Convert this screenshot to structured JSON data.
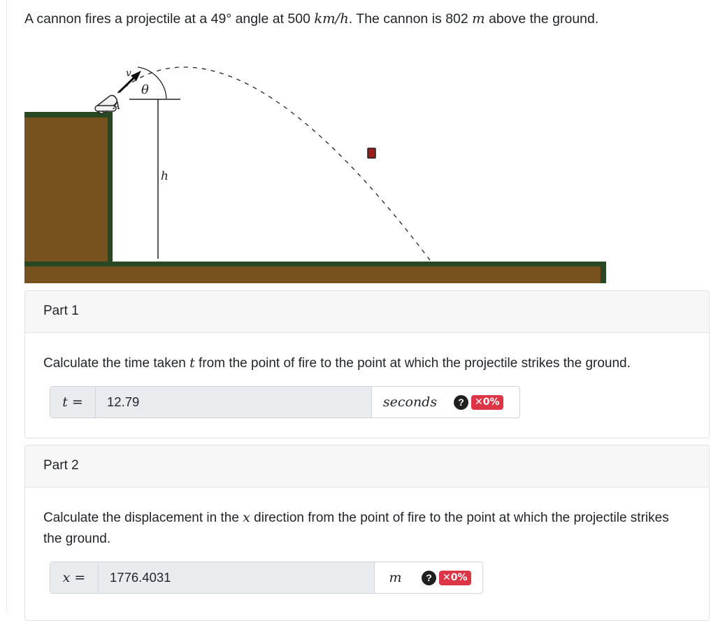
{
  "question": {
    "intro": "A cannon fires a projectile at a ",
    "angle": "49°",
    "mid1": " angle at 500 ",
    "speed_unit": "km/h",
    "mid2": ". The cannon is 802 ",
    "height_unit": "m",
    "end": " above the ground."
  },
  "figure": {
    "label_v": "v",
    "label_theta": "θ",
    "label_a": "A",
    "label_h": "h",
    "colors": {
      "dirt": "#77521f",
      "grass": "#284722",
      "projectile": "#9b1b1b"
    }
  },
  "parts": [
    {
      "title": "Part 1",
      "prompt_before": "Calculate the time taken ",
      "prompt_var": "t",
      "prompt_after": " from the point of fire to the point at which the projectile strikes the ground.",
      "lhs": "t =",
      "value": "12.79",
      "unit": "seconds",
      "help": "?",
      "score": "✕0%"
    },
    {
      "title": "Part 2",
      "prompt_before": "Calculate the displacement in the ",
      "prompt_var": "x",
      "prompt_after": " direction from the point of fire to the point at which the projectile strikes the ground.",
      "lhs": "x =",
      "value": "1776.4031",
      "unit": "m",
      "help": "?",
      "score": "✕0%"
    }
  ]
}
